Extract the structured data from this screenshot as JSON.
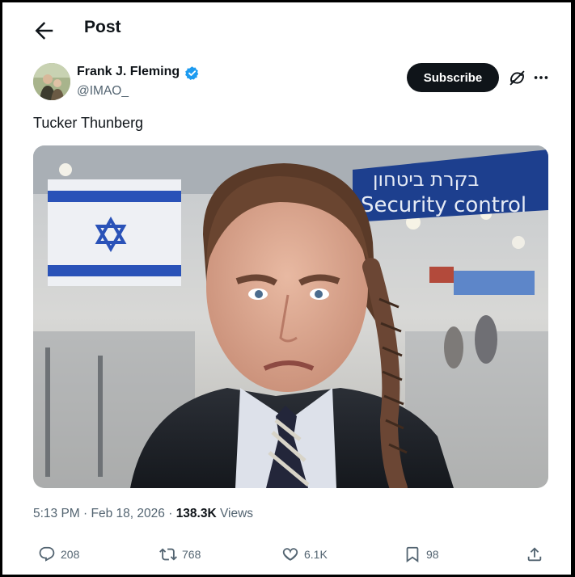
{
  "header": {
    "title": "Post"
  },
  "author": {
    "name": "Frank J. Fleming",
    "handle": "@IMAO_",
    "subscribe_label": "Subscribe"
  },
  "tweet": {
    "text": "Tucker Thunberg"
  },
  "media": {
    "sign_text_hebrew": "בקרת ביטחון",
    "sign_text_english": "Security control"
  },
  "meta": {
    "time": "5:13 PM",
    "separator": "·",
    "date": "Feb 18, 2026",
    "views_count": "138.3K",
    "views_label": "Views"
  },
  "actions": {
    "replies": "208",
    "reposts": "768",
    "likes": "6.1K",
    "bookmarks": "98"
  },
  "colors": {
    "text": "#0f1419",
    "muted": "#536471",
    "verified": "#1d9bf0",
    "subscribe_bg": "#0f1419"
  },
  "icons": [
    "back-arrow-icon",
    "verified-badge-icon",
    "grok-icon",
    "more-icon",
    "reply-icon",
    "repost-icon",
    "like-icon",
    "bookmark-icon",
    "share-icon"
  ]
}
